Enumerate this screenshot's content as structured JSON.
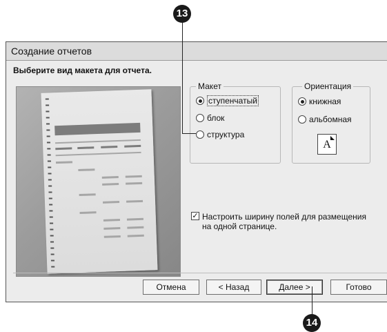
{
  "dialog": {
    "title": "Создание отчетов",
    "prompt": "Выберите вид макета для отчета."
  },
  "layout_group": {
    "title": "Макет",
    "options": [
      "ступенчатый",
      "блок",
      "структура"
    ],
    "selected": "ступенчатый"
  },
  "orientation_group": {
    "title": "Ориентация",
    "options": [
      "книжная",
      "альбомная"
    ],
    "selected": "книжная",
    "icon_letter": "A"
  },
  "fit_fields": {
    "checked": true,
    "label": "Настроить ширину полей для размещения на одной странице."
  },
  "buttons": {
    "cancel": "Отмена",
    "back": "< Назад",
    "next": "Далее >",
    "finish": "Готово"
  },
  "callouts": {
    "layout_option": "13",
    "next_button": "14"
  }
}
